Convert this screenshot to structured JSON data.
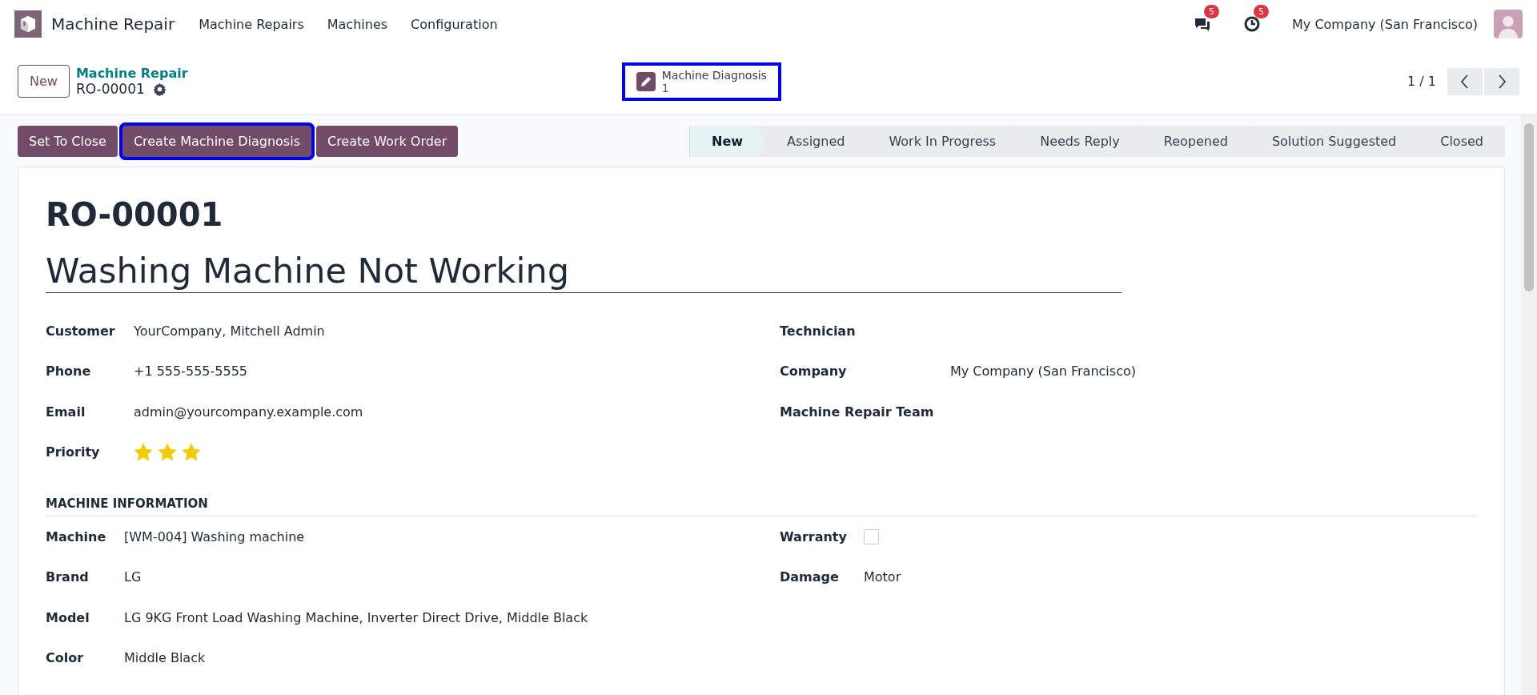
{
  "navbar": {
    "app_name": "Machine Repair",
    "menu": [
      "Machine Repairs",
      "Machines",
      "Configuration"
    ],
    "messages_count": "5",
    "activities_count": "5",
    "company": "My Company (San Francisco)"
  },
  "control_panel": {
    "new_button": "New",
    "breadcrumb": "Machine Repair",
    "record": "RO-00001",
    "smart_button": {
      "label": "Machine Diagnosis",
      "count": "1",
      "highlighted": true
    },
    "pager": "1 / 1"
  },
  "actions": [
    {
      "label": "Set To Close",
      "highlighted": false
    },
    {
      "label": "Create Machine Diagnosis",
      "highlighted": true
    },
    {
      "label": "Create Work Order",
      "highlighted": false
    }
  ],
  "stages": [
    {
      "label": "New",
      "selected": true
    },
    {
      "label": "Assigned",
      "selected": false
    },
    {
      "label": "Work In Progress",
      "selected": false
    },
    {
      "label": "Needs Reply",
      "selected": false
    },
    {
      "label": "Reopened",
      "selected": false
    },
    {
      "label": "Solution Suggested",
      "selected": false
    },
    {
      "label": "Closed",
      "selected": false
    }
  ],
  "form": {
    "reference": "RO-00001",
    "title": "Washing Machine Not Working",
    "left_fields": [
      {
        "kind": "text",
        "label": "Customer",
        "value": "YourCompany, Mitchell Admin"
      },
      {
        "kind": "text",
        "label": "Phone",
        "value": "+1 555-555-5555"
      },
      {
        "kind": "text",
        "label": "Email",
        "value": "admin@yourcompany.example.com"
      },
      {
        "kind": "stars",
        "label": "Priority",
        "stars": 3
      }
    ],
    "right_fields": [
      {
        "kind": "text",
        "label": "Technician"
      },
      {
        "kind": "text",
        "label": "Company",
        "value": "My Company (San Francisco)"
      },
      {
        "kind": "text",
        "label": "Machine Repair Team"
      }
    ],
    "section": "MACHINE INFORMATION",
    "machine_left": [
      {
        "kind": "text",
        "label": "Machine",
        "value": "[WM-004] Washing machine"
      },
      {
        "kind": "text",
        "label": "Brand",
        "value": "LG"
      },
      {
        "kind": "text",
        "label": "Model",
        "value": "LG 9KG Front Load Washing Machine, Inverter Direct Drive, Middle Black"
      },
      {
        "kind": "text",
        "label": "Color",
        "value": "Middle Black"
      }
    ],
    "machine_right": [
      {
        "kind": "checkbox",
        "label": "Warranty",
        "checked": false
      },
      {
        "kind": "text",
        "label": "Damage",
        "value": "Motor"
      }
    ]
  }
}
